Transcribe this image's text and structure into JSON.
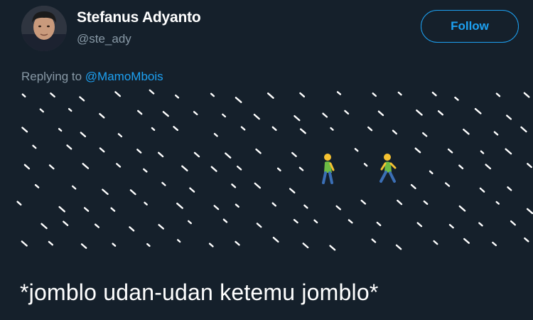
{
  "tweet": {
    "author_name": "Stefanus Adyanto",
    "author_handle": "@ste_ady",
    "follow_label": "Follow",
    "replying_prefix": "Replying to",
    "replying_mention": "@MamoMbois",
    "body_text": "*jomblo udan-udan ketemu jomblo*"
  },
  "media": {
    "rain_glyph": "`",
    "walkers": [
      "person-walking-emoji",
      "person-walking-emoji"
    ]
  },
  "colors": {
    "background": "#15202b",
    "accent": "#1da1f2",
    "muted": "#8899a6",
    "text": "#ffffff"
  }
}
